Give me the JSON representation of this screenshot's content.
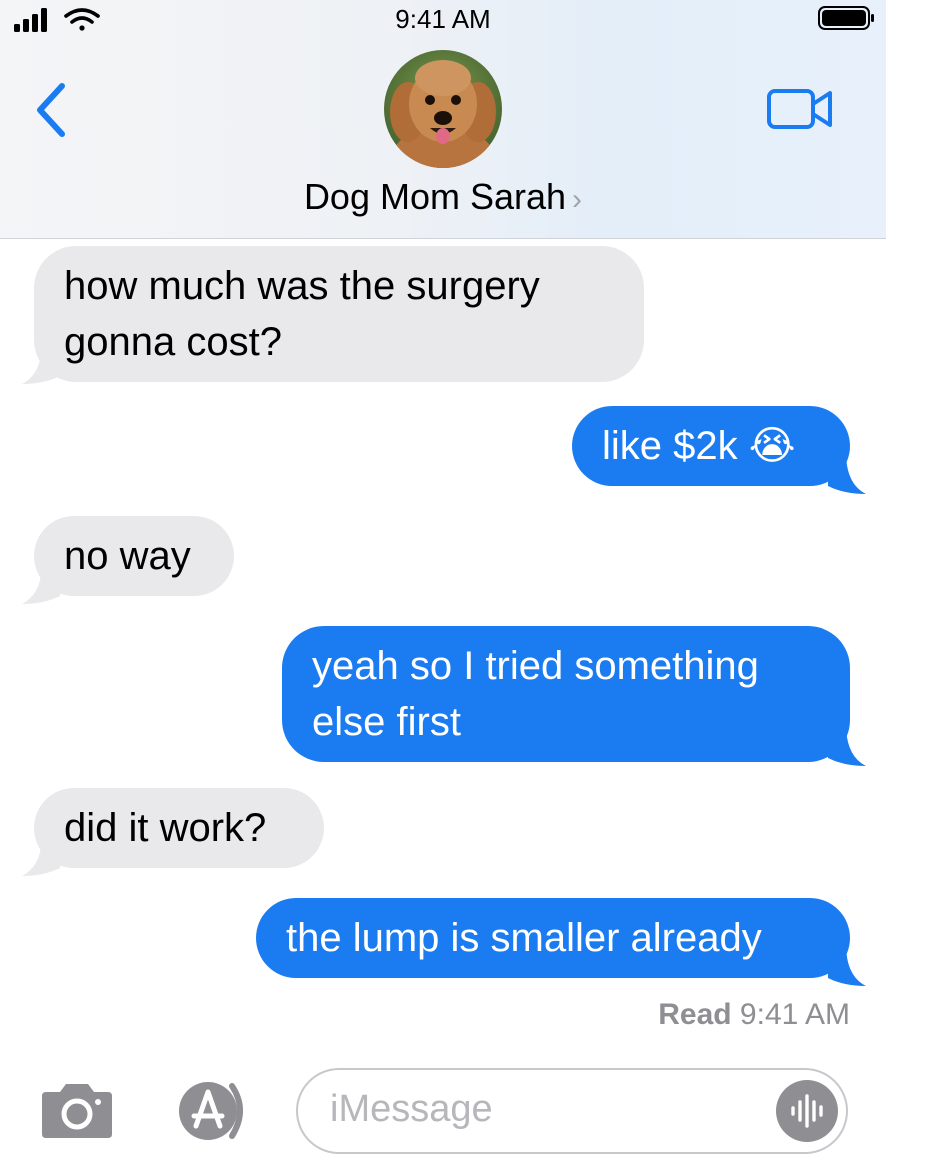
{
  "status_bar": {
    "time": "9:41 AM"
  },
  "header": {
    "contact_name": "Dog Mom Sarah",
    "chevron": "›"
  },
  "messages": [
    {
      "direction": "incoming",
      "text": "how much was the surgery gonna cost?"
    },
    {
      "direction": "outgoing",
      "text": "like $2k 😭"
    },
    {
      "direction": "incoming",
      "text": "no way"
    },
    {
      "direction": "outgoing",
      "text": "yeah so I tried something else first"
    },
    {
      "direction": "incoming",
      "text": "did it work?"
    },
    {
      "direction": "outgoing",
      "text": "the lump is smaller already"
    }
  ],
  "receipt": {
    "label": "Read",
    "time": "9:41 AM"
  },
  "composer": {
    "placeholder": "iMessage"
  },
  "icons": {
    "back": "chevron-left-icon",
    "video": "video-camera-icon",
    "camera": "camera-icon",
    "apps": "app-store-icon",
    "voice": "waveform-icon",
    "signal": "cellular-signal-icon",
    "wifi": "wifi-icon",
    "battery": "battery-icon"
  },
  "colors": {
    "outgoing_bubble": "#1b7cf2",
    "incoming_bubble": "#e9e9eb",
    "accent": "#1b7cf2"
  }
}
